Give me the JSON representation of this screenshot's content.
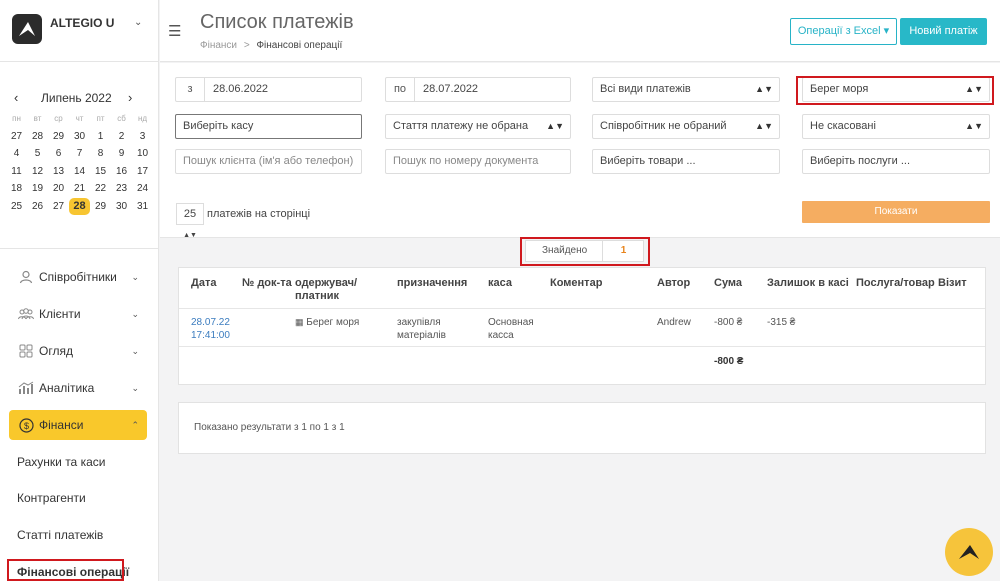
{
  "brand": {
    "name": "ALTEGIO U"
  },
  "calendar": {
    "prev": "‹",
    "next": "›",
    "title": "Липень 2022",
    "dow": [
      "пн",
      "вт",
      "ср",
      "чт",
      "пт",
      "сб",
      "нд"
    ],
    "weeks": [
      [
        "27",
        "28",
        "29",
        "30",
        "1",
        "2",
        "3"
      ],
      [
        "4",
        "5",
        "6",
        "7",
        "8",
        "9",
        "10"
      ],
      [
        "11",
        "12",
        "13",
        "14",
        "15",
        "16",
        "17"
      ],
      [
        "18",
        "19",
        "20",
        "21",
        "22",
        "23",
        "24"
      ],
      [
        "25",
        "26",
        "27",
        "28",
        "29",
        "30",
        "31"
      ]
    ],
    "selected": "28"
  },
  "nav": {
    "items": [
      {
        "label": "Співробітники",
        "icon": "user-icon"
      },
      {
        "label": "Клієнти",
        "icon": "users-icon"
      },
      {
        "label": "Огляд",
        "icon": "grid-icon"
      },
      {
        "label": "Аналітика",
        "icon": "chart-icon"
      },
      {
        "label": "Фінанси",
        "icon": "dollar-icon"
      }
    ],
    "sub": [
      "Рахунки та каси",
      "Контрагенти",
      "Статті платежів",
      "Фінансові операції"
    ]
  },
  "header": {
    "title": "Список платежів",
    "breadcrumb_parent": "Фінанси",
    "breadcrumb_sep": ">",
    "breadcrumb_current": "Фінансові операції",
    "excel_button": "Операції з Excel ▾",
    "new_button": "Новий платіж"
  },
  "filters": {
    "from_prefix": "з",
    "from_value": "28.06.2022",
    "to_prefix": "по",
    "to_value": "28.07.2022",
    "payment_type": "Всі види платежів",
    "counterparty": "Берег моря",
    "cash": "Виберіть касу",
    "article": "Стаття платежу не обрана",
    "employee": "Співробітник не обраний",
    "cancel_state": "Не скасовані",
    "client_placeholder": "Пошук клієнта (ім'я або телефон)",
    "doc_placeholder": "Пошук по номеру документа",
    "goods_placeholder": "Виберіть товари ...",
    "services_placeholder": "Виберіть послуги ...",
    "per_page_value": "25",
    "per_page_label": "платежів на сторінці",
    "show_button": "Показати"
  },
  "found": {
    "label": "Знайдено",
    "count": "1"
  },
  "table": {
    "headers": [
      "Дата",
      "№ док-та",
      "одержувач/ платник",
      "призначення",
      "каса",
      "Коментар",
      "Автор",
      "Сума",
      "Залишок в касі",
      "Послуга/товар",
      "Візит"
    ],
    "row": {
      "date": "28.07.22 17:41:00",
      "doc": "",
      "payee": "Берег моря",
      "purpose": "закупівля матеріалів",
      "cash": "Основная касса",
      "comment": "",
      "author": "Andrew",
      "sum": "-800 ₴",
      "balance": "-315 ₴"
    },
    "total": "-800 ₴"
  },
  "results_text": "Показано результати з 1 по 1 з 1"
}
